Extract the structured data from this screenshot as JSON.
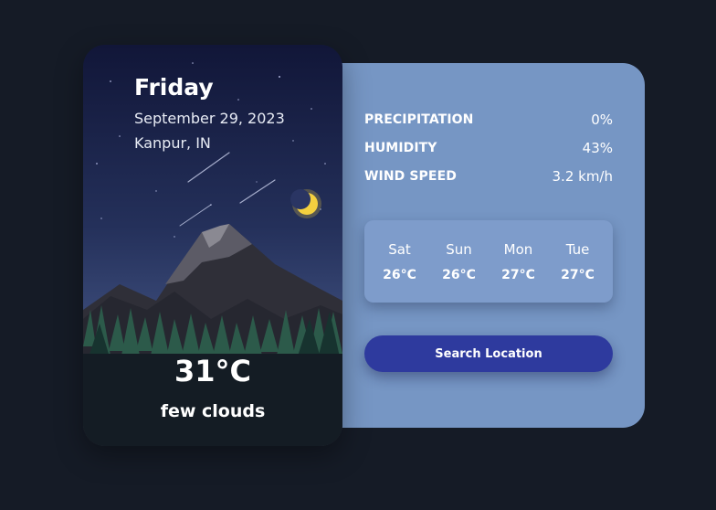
{
  "today": {
    "day": "Friday",
    "date": "September 29, 2023",
    "location": "Kanpur, IN",
    "temperature": "31°C",
    "description": "few clouds"
  },
  "stats": [
    {
      "label": "PRECIPITATION",
      "value": "0%"
    },
    {
      "label": "HUMIDITY",
      "value": "43%"
    },
    {
      "label": "WIND SPEED",
      "value": "3.2 km/h"
    }
  ],
  "forecast": [
    {
      "day": "Sat",
      "temp": "26°C"
    },
    {
      "day": "Sun",
      "temp": "26°C"
    },
    {
      "day": "Mon",
      "temp": "27°C"
    },
    {
      "day": "Tue",
      "temp": "27°C"
    }
  ],
  "search_button": "Search Location",
  "colors": {
    "background": "#151b26",
    "panel": "#7696c4",
    "button": "#2e3a9e",
    "moon": "#f4d03f"
  },
  "icons": {
    "moon": "crescent-moon-icon",
    "illustration": "night-mountain-illustration"
  }
}
